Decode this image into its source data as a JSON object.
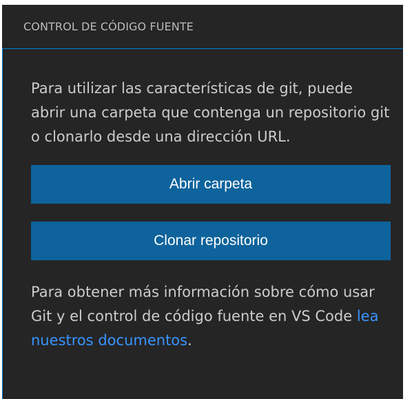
{
  "panel": {
    "title": "CONTROL DE CÓDIGO FUENTE"
  },
  "welcome": {
    "intro_text": "Para utilizar las características de git, puede abrir una carpeta que contenga un repositorio git o clonarlo desde una dirección URL.",
    "open_folder_label": "Abrir carpeta",
    "clone_repo_label": "Clonar repositorio",
    "info_prefix": "Para obtener más información sobre cómo usar Git y el control de código fuente en VS Code ",
    "docs_link_label": "lea nuestros documentos",
    "info_suffix": "."
  },
  "colors": {
    "panel_background": "#252526",
    "button_background": "#0e639c",
    "focus_border": "#007fd4",
    "link": "#3794ff"
  }
}
